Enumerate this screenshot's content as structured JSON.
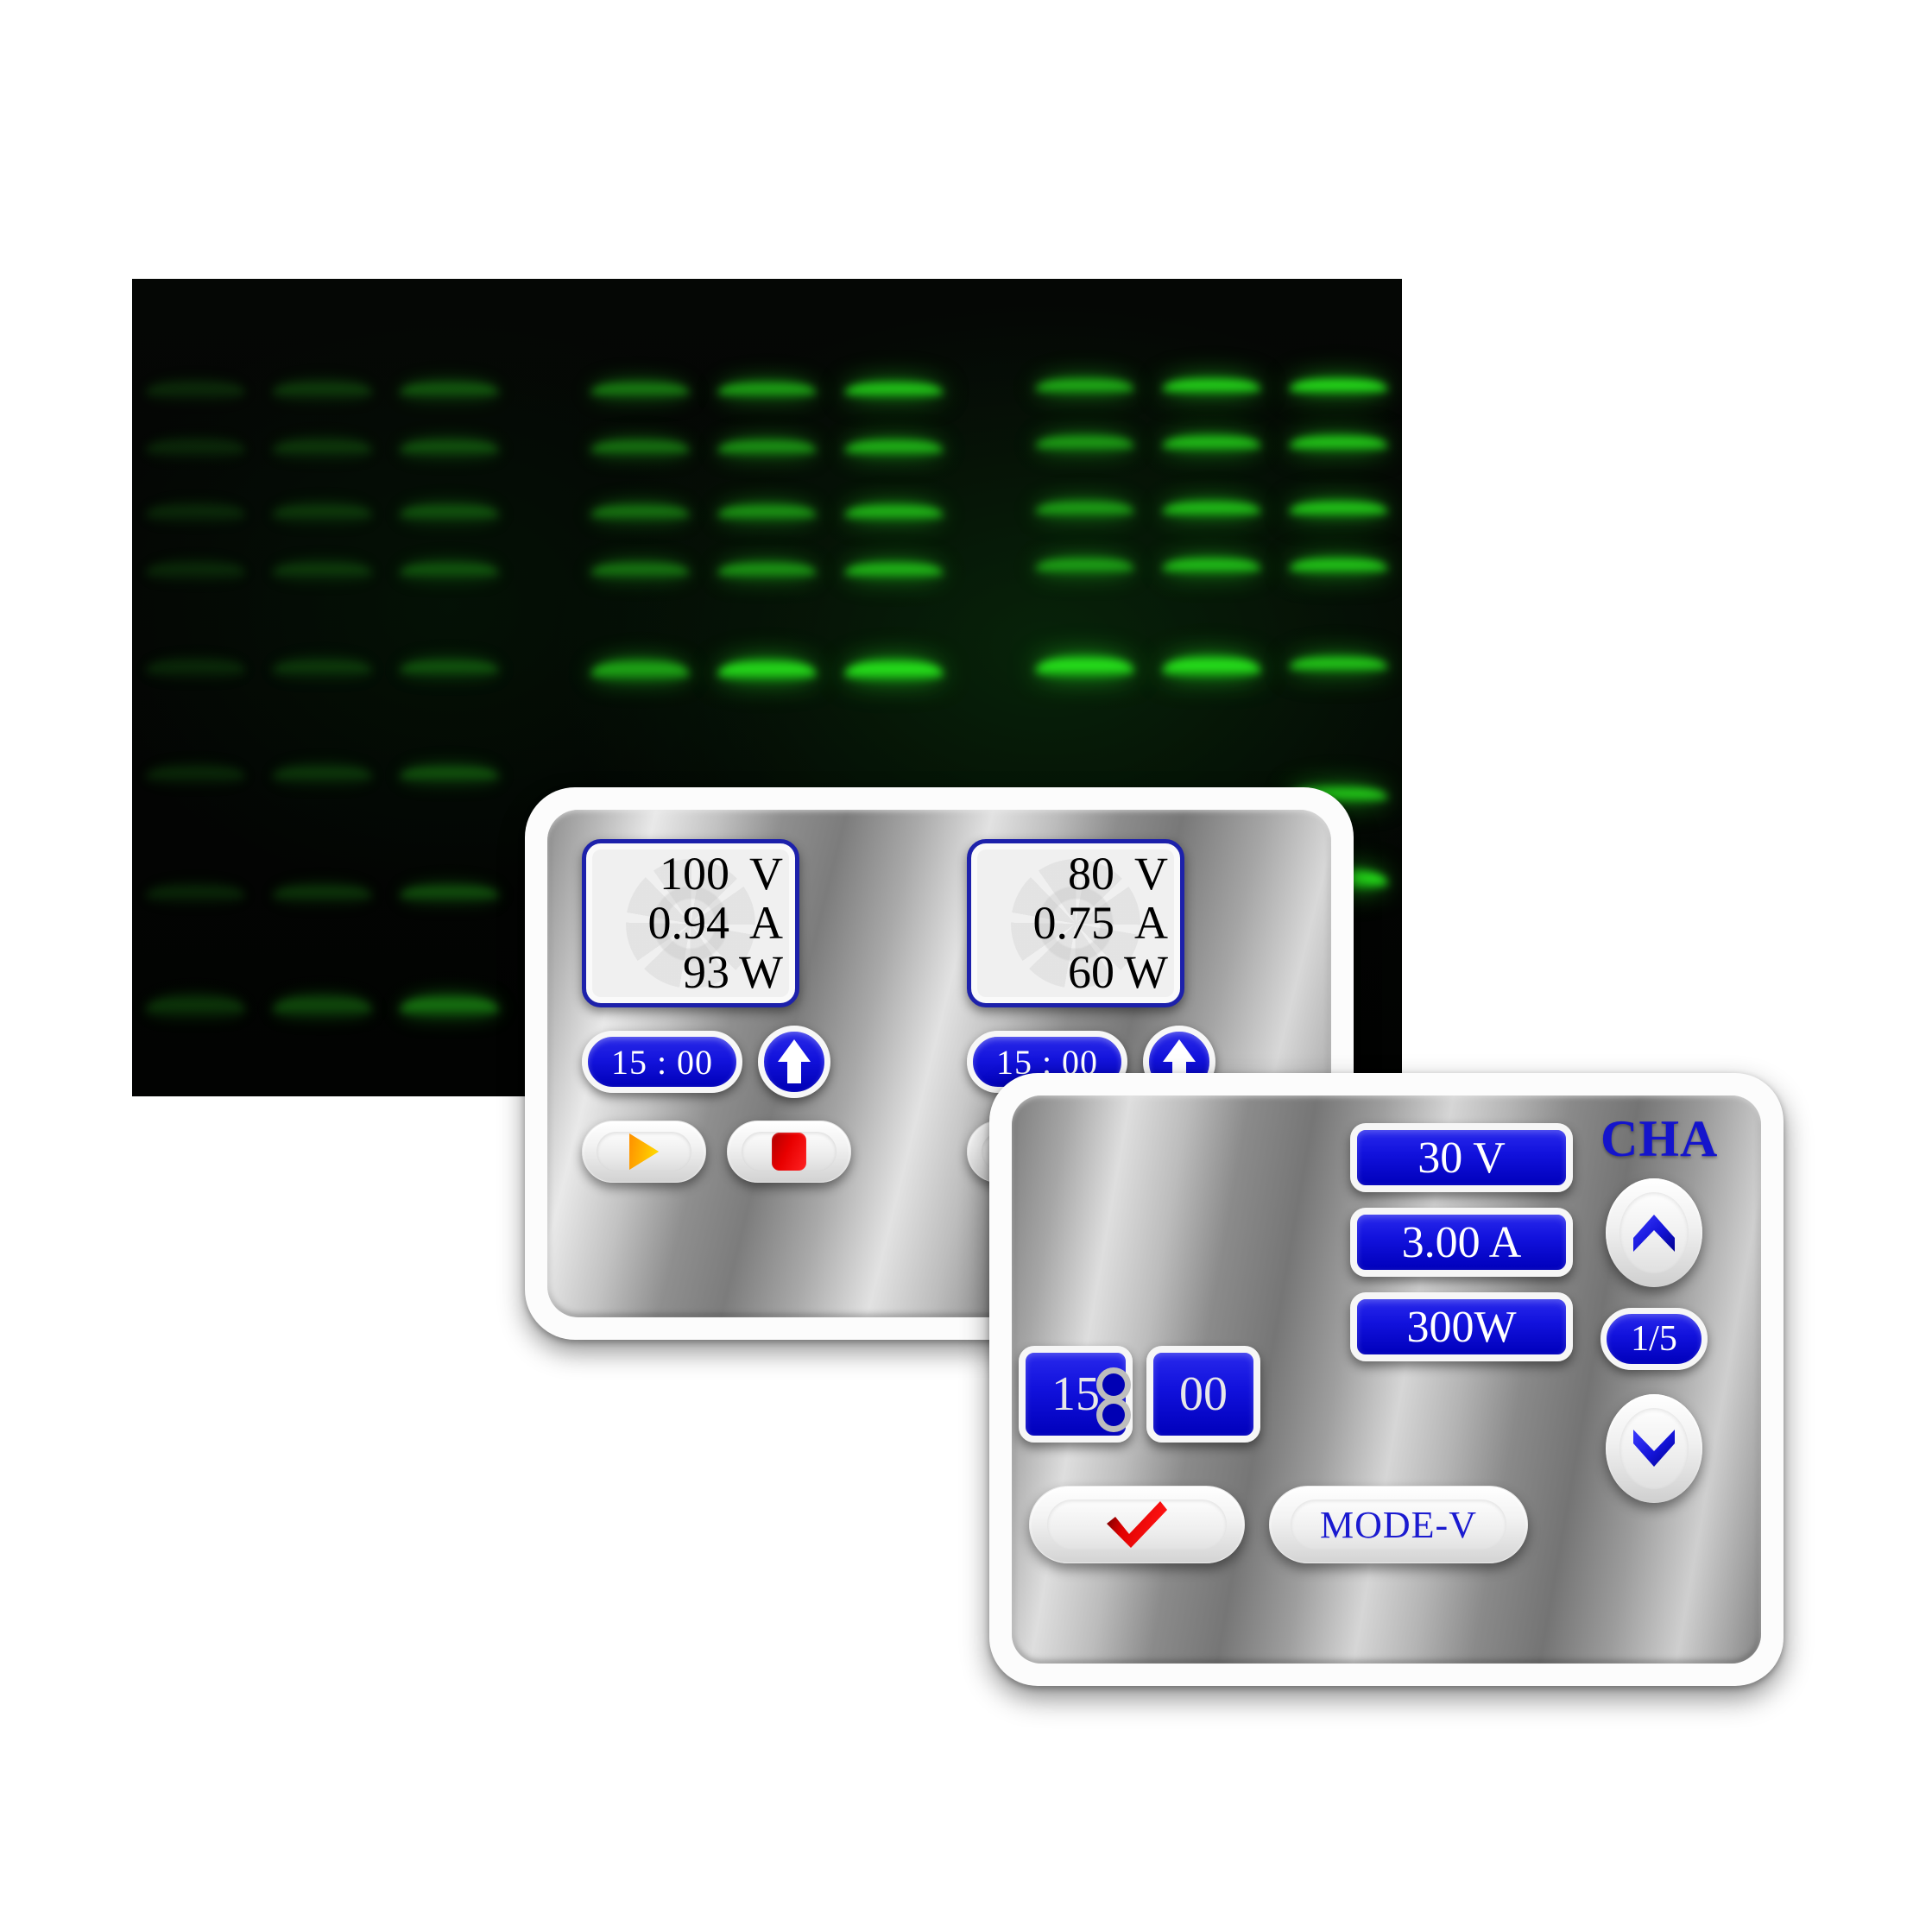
{
  "scene": {
    "title": "Electrophoresis gel image with power supply control panels",
    "background_color": "#ffffff"
  },
  "gel": {
    "name": "dna-gel-electrophoresis",
    "background_color": "#040604",
    "band_color_bright": "#2bdc1c",
    "band_color_dim": "#0d4a0a",
    "lanes": [
      {
        "id": "lane-1",
        "x_pct": 5,
        "brightness": 0.22,
        "bands_y_pct": [
          12.5,
          19.5,
          27.5,
          34.5,
          46.5,
          59.5,
          74.0,
          87.5
        ]
      },
      {
        "id": "lane-2",
        "x_pct": 15,
        "brightness": 0.3,
        "bands_y_pct": [
          12.5,
          19.5,
          27.5,
          34.5,
          46.5,
          59.5,
          74.0,
          87.5
        ]
      },
      {
        "id": "lane-3",
        "x_pct": 25,
        "brightness": 0.45,
        "bands_y_pct": [
          12.5,
          19.5,
          27.5,
          34.5,
          46.5,
          59.5,
          74.0,
          87.5
        ]
      },
      {
        "id": "lane-4",
        "x_pct": 40,
        "brightness": 0.62,
        "bands_y_pct": [
          12.5,
          19.5,
          27.5,
          34.5,
          46.5
        ]
      },
      {
        "id": "lane-5",
        "x_pct": 50,
        "brightness": 0.78,
        "bands_y_pct": [
          12.5,
          19.5,
          27.5,
          34.5,
          46.5
        ]
      },
      {
        "id": "lane-6",
        "x_pct": 60,
        "brightness": 0.92,
        "bands_y_pct": [
          12.5,
          19.5,
          27.5,
          34.5,
          46.5
        ]
      },
      {
        "id": "lane-7",
        "x_pct": 75,
        "brightness": 0.82,
        "bands_y_pct": [
          12.0,
          19.0,
          27.0,
          34.0,
          46.0
        ]
      },
      {
        "id": "lane-8",
        "x_pct": 85,
        "brightness": 0.96,
        "bands_y_pct": [
          12.0,
          19.0,
          27.0,
          34.0,
          46.0
        ]
      },
      {
        "id": "lane-9",
        "x_pct": 95,
        "brightness": 1.0,
        "bands_y_pct": [
          12.0,
          19.0,
          27.0,
          34.0,
          46.0,
          62.0,
          72.0
        ]
      }
    ]
  },
  "panel_dual": {
    "name": "dual-channel-power-supply-panel",
    "channels": [
      {
        "id": "channel-left",
        "display": {
          "voltage_value": "100",
          "voltage_unit": "V",
          "current_value": "0.94",
          "current_unit": "A",
          "power_value": "93",
          "power_unit": "W"
        },
        "timer": "15 : 00",
        "up_button_icon": "arrow-up-icon",
        "run_button_icon": "play-icon",
        "stop_button_icon": "stop-icon"
      },
      {
        "id": "channel-right",
        "display": {
          "voltage_value": "80",
          "voltage_unit": "V",
          "current_value": "0.75",
          "current_unit": "A",
          "power_value": "60",
          "power_unit": "W"
        },
        "timer": "15 : 00",
        "up_button_icon": "arrow-up-icon",
        "run_button_icon": "play-icon",
        "stop_button_icon": "stop-icon"
      }
    ],
    "colors": {
      "lcd_border": "#1d21ab",
      "lcd_background": "#f0f0f0",
      "timer_blue": "#0000bb",
      "play_orange": "#ffb300",
      "stop_red": "#e80000"
    }
  },
  "panel_single": {
    "name": "single-channel-power-supply-panel",
    "channel_label": "CHA",
    "readouts": [
      {
        "id": "voltage-readout",
        "text": "30 V"
      },
      {
        "id": "current-readout",
        "text": "3.00 A"
      },
      {
        "id": "power-readout",
        "text": "300W"
      }
    ],
    "timer": {
      "minutes": "15",
      "seconds": "00",
      "separator_icon": "colon-icon"
    },
    "page_indicator": "1/5",
    "up_button_icon": "chevron-up-icon",
    "down_button_icon": "chevron-down-icon",
    "confirm_button_icon": "check-icon",
    "mode_button_label": "MODE-V",
    "colors": {
      "readout_blue": "#0000bb",
      "label_blue": "#1414cc",
      "check_red": "#e00000",
      "mode_text_blue": "#1a1ad0"
    }
  }
}
